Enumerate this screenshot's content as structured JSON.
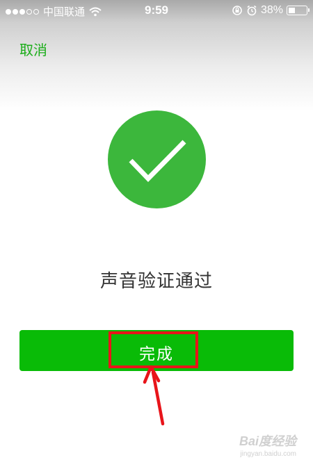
{
  "status_bar": {
    "carrier": "中国联通",
    "time": "9:59",
    "battery": "38%",
    "battery_level": 0.38,
    "signal_filled": 3,
    "signal_total": 5
  },
  "header": {
    "cancel_label": "取消"
  },
  "main": {
    "result_text": "声音验证通过",
    "done_label": "完成",
    "check_icon": "checkmark-circle-icon"
  },
  "watermark": {
    "main": "Bai度经验",
    "sub": "jingyan.baidu.com"
  },
  "colors": {
    "accent_green": "#1aad19",
    "button_green": "#09bb07",
    "check_circle": "#3cb73c",
    "annotation_red": "#e8141a"
  }
}
